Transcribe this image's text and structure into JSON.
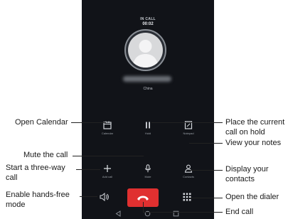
{
  "call": {
    "status": "IN CALL",
    "duration": "00:02",
    "location": "China"
  },
  "controls": {
    "calendar": "Calendar",
    "hold": "Hold",
    "notepad": "Notepad",
    "add_call": "Add call",
    "mute": "Mute",
    "contacts": "Contacts"
  },
  "annotations": {
    "open_calendar": "Open Calendar",
    "mute_call": "Mute the call",
    "three_way_1": "Start a three-way",
    "three_way_2": "call",
    "hands_free_1": "Enable hands-free",
    "hands_free_2": "mode",
    "hold_1": "Place the current",
    "hold_2": "call on hold",
    "notes": "View your notes",
    "contacts_1": "Display your",
    "contacts_2": "contacts",
    "dialer": "Open the dialer",
    "end_call": "End call"
  },
  "colors": {
    "screen_bg": "#111318",
    "end_call": "#e03030"
  }
}
